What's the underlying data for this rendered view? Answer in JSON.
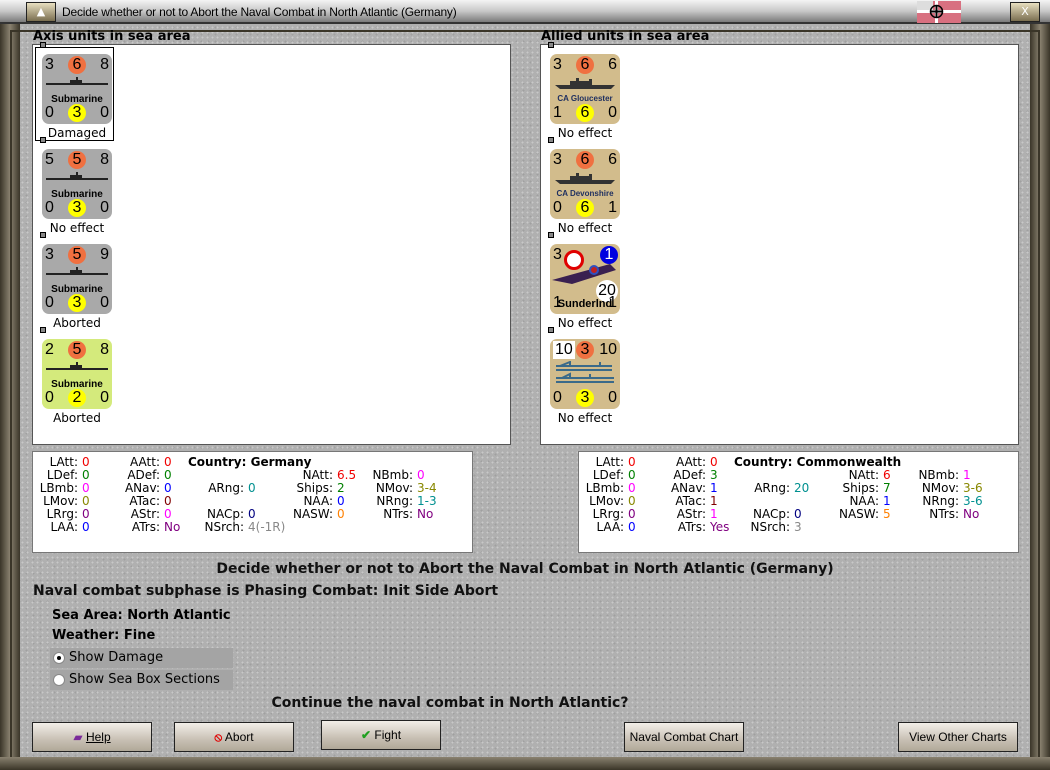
{
  "window": {
    "title": "Decide whether or not to Abort the Naval Combat in North Atlantic (Germany)",
    "min_icon": "triangle-up-icon",
    "close_icon": "x-icon",
    "close_label": "X"
  },
  "axis": {
    "header": "Axis units in sea area",
    "units": [
      {
        "tl": "3",
        "tc": "6",
        "tr": "8",
        "bl": "0",
        "bc": "3",
        "br": "0",
        "name": "Submarine",
        "status": "Damaged",
        "bg": "#a9a9a9",
        "type": "sub",
        "selected": true
      },
      {
        "tl": "5",
        "tc": "5",
        "tr": "8",
        "bl": "0",
        "bc": "3",
        "br": "0",
        "name": "Submarine",
        "status": "No effect",
        "bg": "#a9a9a9",
        "type": "sub"
      },
      {
        "tl": "3",
        "tc": "5",
        "tr": "9",
        "bl": "0",
        "bc": "3",
        "br": "0",
        "name": "Submarine",
        "status": "Aborted",
        "bg": "#a9a9a9",
        "type": "sub"
      },
      {
        "tl": "2",
        "tc": "5",
        "tr": "8",
        "bl": "0",
        "bc": "2",
        "br": "0",
        "name": "Submarine",
        "status": "Aborted",
        "bg": "#d4ea7c",
        "type": "sub"
      }
    ]
  },
  "allied": {
    "header": "Allied units in sea area",
    "units": [
      {
        "tl": "3",
        "tc": "6",
        "tr": "6",
        "bl": "1",
        "bc": "6",
        "br": "0",
        "name": "CA Gloucester",
        "status": "No effect",
        "bg": "#d2bc8c",
        "type": "ship"
      },
      {
        "tl": "3",
        "tc": "6",
        "tr": "6",
        "bl": "0",
        "bc": "6",
        "br": "1",
        "name": "CA Devonshire",
        "status": "No effect",
        "bg": "#d2bc8c",
        "type": "ship"
      },
      {
        "tl": "3",
        "tc": "1",
        "tr": "20",
        "bl": "1",
        "bc": "",
        "br": "1",
        "name": "Sunderlnd",
        "status": "No effect",
        "bg": "#d2bc8c",
        "type": "plane"
      },
      {
        "tl": "10",
        "tc": "3",
        "tr": "10",
        "bl": "0",
        "bc": "3",
        "br": "0",
        "name": "",
        "status": "No effect",
        "bg": "#d2bc8c",
        "type": "convoy"
      }
    ]
  },
  "axis_stats": {
    "country": "Country: Germany",
    "cells": [
      [
        "LAtt:",
        "0",
        "#f00000"
      ],
      [
        "AAtt:",
        "0",
        "#f00000"
      ],
      [
        "LDef:",
        "0",
        "#008000"
      ],
      [
        "ADef:",
        "0",
        "#008000"
      ],
      [
        "NAtt:",
        "6.5",
        "#f00000"
      ],
      [
        "NBmb:",
        "0",
        "#ff00ff"
      ],
      [
        "LBmb:",
        "0",
        "#ff00ff"
      ],
      [
        "ANav:",
        "0",
        "#0000ff"
      ],
      [
        "ARng:",
        "0",
        "#009090"
      ],
      [
        "Ships:",
        "2",
        "#008000"
      ],
      [
        "NMov:",
        "3-4",
        "#888800"
      ],
      [
        "LMov:",
        "0",
        "#888800"
      ],
      [
        "ATac:",
        "0",
        "#800000"
      ],
      [
        "NAA:",
        "0",
        "#0000ff"
      ],
      [
        "NRng:",
        "1-3",
        "#009090"
      ],
      [
        "LRrg:",
        "0",
        "#800080"
      ],
      [
        "AStr:",
        "0",
        "#ff00ff"
      ],
      [
        "NACp:",
        "0",
        "#000080"
      ],
      [
        "NASW:",
        "0",
        "#ff8000"
      ],
      [
        "NTrs:",
        "No",
        "#800080"
      ],
      [
        "LAA:",
        "0",
        "#0000ff"
      ],
      [
        "ATrs:",
        "No",
        "#800080"
      ],
      [
        "NSrch:",
        "4(-1R)",
        "#888888"
      ]
    ]
  },
  "allied_stats": {
    "country": "Country: Commonwealth",
    "cells": [
      [
        "LAtt:",
        "0",
        "#f00000"
      ],
      [
        "AAtt:",
        "0",
        "#f00000"
      ],
      [
        "LDef:",
        "0",
        "#008000"
      ],
      [
        "ADef:",
        "3",
        "#008000"
      ],
      [
        "NAtt:",
        "6",
        "#f00000"
      ],
      [
        "NBmb:",
        "1",
        "#ff00ff"
      ],
      [
        "LBmb:",
        "0",
        "#ff00ff"
      ],
      [
        "ANav:",
        "1",
        "#0000ff"
      ],
      [
        "ARng:",
        "20",
        "#009090"
      ],
      [
        "Ships:",
        "7",
        "#008000"
      ],
      [
        "NMov:",
        "3-6",
        "#888800"
      ],
      [
        "LMov:",
        "0",
        "#888800"
      ],
      [
        "ATac:",
        "1",
        "#800000"
      ],
      [
        "NAA:",
        "1",
        "#0000ff"
      ],
      [
        "NRng:",
        "3-6",
        "#009090"
      ],
      [
        "LRrg:",
        "0",
        "#800080"
      ],
      [
        "AStr:",
        "1",
        "#ff00ff"
      ],
      [
        "NACp:",
        "0",
        "#000080"
      ],
      [
        "NASW:",
        "5",
        "#ff8000"
      ],
      [
        "NTrs:",
        "No",
        "#800080"
      ],
      [
        "LAA:",
        "0",
        "#0000ff"
      ],
      [
        "ATrs:",
        "Yes",
        "#800080"
      ],
      [
        "NSrch:",
        "3",
        "#888888"
      ]
    ]
  },
  "main": {
    "heading": "Decide whether or not to Abort the Naval Combat in North Atlantic (Germany)",
    "subphase": "Naval combat subphase is Phasing Combat: Init Side Abort",
    "sea_area_label": "Sea Area:",
    "sea_area": "North Atlantic",
    "weather_label": "Weather:",
    "weather": "Fine",
    "show_damage": "Show Damage",
    "show_sections": "Show Sea Box Sections",
    "question": "Continue the naval combat in North Atlantic?"
  },
  "buttons": {
    "help": "Help",
    "abort": "Abort",
    "fight": "Fight",
    "chart": "Naval Combat Chart",
    "other": "View Other Charts"
  }
}
